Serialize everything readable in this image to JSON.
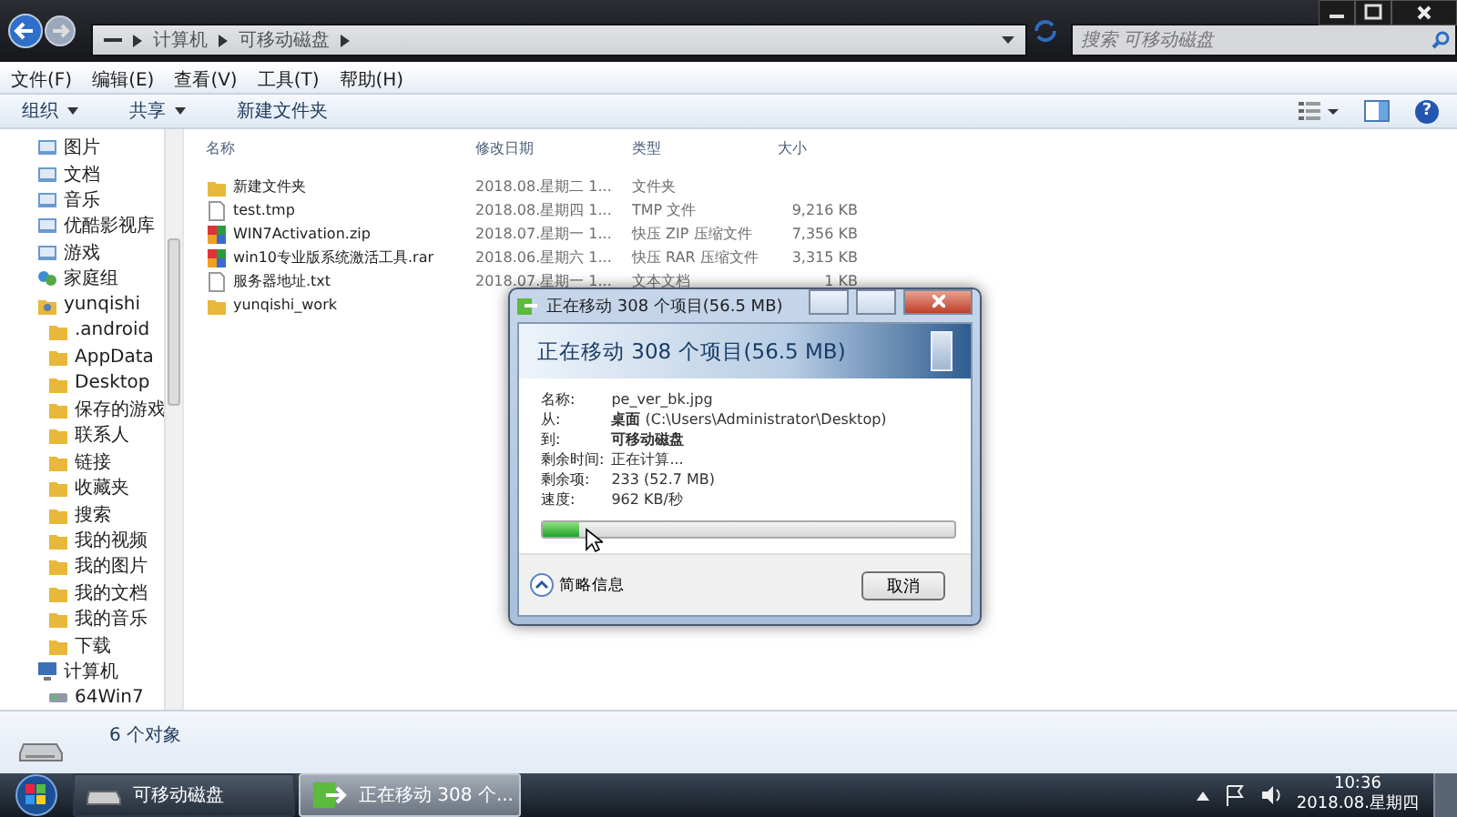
{
  "address_bar": {
    "segments": [
      "计算机",
      "可移动磁盘"
    ]
  },
  "search": {
    "placeholder": "搜索 可移动磁盘"
  },
  "help": "?",
  "menu": [
    "文件(F)",
    "编辑(E)",
    "查看(V)",
    "工具(T)",
    "帮助(H)"
  ],
  "toolbar": [
    {
      "label": "组织",
      "dropdown": true
    },
    {
      "label": "共享",
      "dropdown": true
    },
    {
      "label": "新建文件夹",
      "dropdown": false
    }
  ],
  "nav": [
    {
      "label": "图片",
      "kind": "library"
    },
    {
      "label": "文档",
      "kind": "library"
    },
    {
      "label": "音乐",
      "kind": "library"
    },
    {
      "label": "优酷影视库",
      "kind": "library"
    },
    {
      "label": "游戏",
      "kind": "library"
    },
    {
      "label": "家庭组",
      "kind": "homegroup"
    },
    {
      "label": "yunqishi",
      "kind": "user",
      "children": [
        {
          "label": ".android",
          "kind": "folder"
        },
        {
          "label": "AppData",
          "kind": "folder"
        },
        {
          "label": "Desktop",
          "kind": "folder"
        },
        {
          "label": "保存的游戏",
          "kind": "folder"
        },
        {
          "label": "联系人",
          "kind": "folder"
        },
        {
          "label": "链接",
          "kind": "folder"
        },
        {
          "label": "收藏夹",
          "kind": "folder"
        },
        {
          "label": "搜索",
          "kind": "folder"
        },
        {
          "label": "我的视频",
          "kind": "folder"
        },
        {
          "label": "我的图片",
          "kind": "folder"
        },
        {
          "label": "我的文档",
          "kind": "folder"
        },
        {
          "label": "我的音乐",
          "kind": "folder"
        },
        {
          "label": "下载",
          "kind": "folder"
        }
      ]
    },
    {
      "label": "计算机",
      "kind": "computer",
      "children": [
        {
          "label": "64Win7",
          "kind": "drive"
        }
      ]
    }
  ],
  "table": {
    "columns": [
      "名称",
      "修改日期",
      "类型",
      "大小"
    ],
    "rows": [
      {
        "kind": "folder",
        "name": "新建文件夹",
        "date": "2018.08.星期二 1...",
        "type": "文件夹",
        "size": ""
      },
      {
        "kind": "file",
        "name": "test.tmp",
        "date": "2018.08.星期四 1...",
        "type": "TMP 文件",
        "size": "9,216 KB"
      },
      {
        "kind": "archive",
        "name": "WIN7Activation.zip",
        "date": "2018.07.星期一 1...",
        "type": "快压 ZIP 压缩文件",
        "size": "7,356 KB"
      },
      {
        "kind": "archive",
        "name": "win10专业版系统激活工具.rar",
        "date": "2018.06.星期六 1...",
        "type": "快压 RAR 压缩文件",
        "size": "3,315 KB"
      },
      {
        "kind": "file",
        "name": "服务器地址.txt",
        "date": "2018.07.星期一 1...",
        "type": "文本文档",
        "size": "1 KB"
      },
      {
        "kind": "folder",
        "name": "yunqishi_work",
        "date": "",
        "type": "",
        "size": ""
      }
    ]
  },
  "status_bar": {
    "count": "6 个对象"
  },
  "dialog": {
    "title": "正在移动 308 个项目(56.5 MB)",
    "heading": "正在移动 308 个项目(56.5 MB)",
    "fields": [
      {
        "label": "名称:",
        "value": "pe_ver_bk.jpg"
      },
      {
        "label": "从:",
        "value": "**桌面** (C:\\Users\\Administrator\\Desktop)"
      },
      {
        "label": "到:",
        "value": "**可移动磁盘**"
      },
      {
        "label": "剩余时间:",
        "value": "正在计算..."
      },
      {
        "label": "剩余项:",
        "value": "233 (52.7 MB)"
      },
      {
        "label": "速度:",
        "value": "962 KB/秒"
      }
    ],
    "progress": {
      "level": 0.09
    },
    "details_toggle": "简略信息",
    "cancel": "取消"
  },
  "taskbar": {
    "tasks": [
      {
        "label": "可移动磁盘",
        "kind": "drive",
        "selected": false
      },
      {
        "label": "正在移动 308 个...",
        "kind": "copy",
        "selected": true
      }
    ],
    "clock": {
      "time": "10:36",
      "date": "2018.08.星期四"
    }
  }
}
